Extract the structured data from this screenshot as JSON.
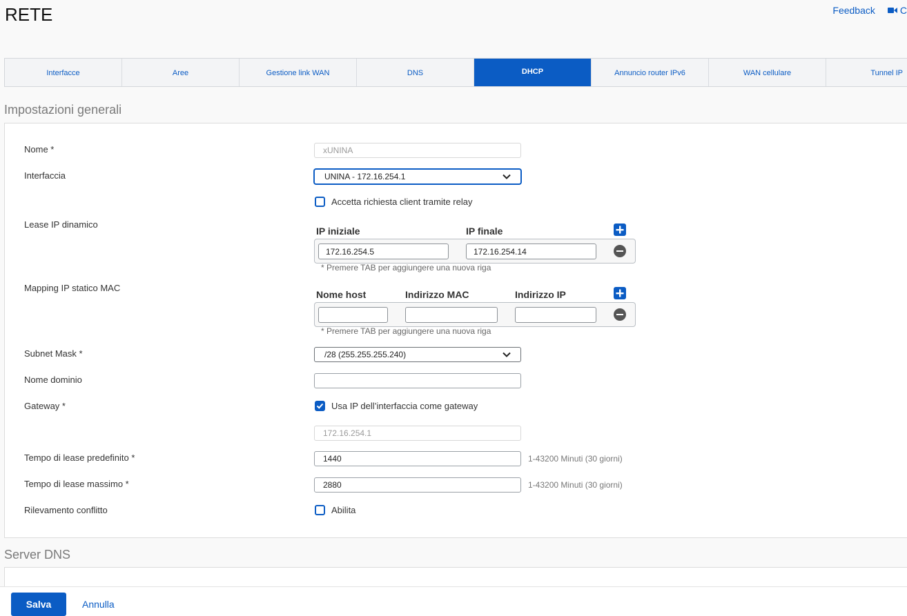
{
  "page": {
    "title": "RETE"
  },
  "header": {
    "feedback": "Feedback",
    "extra": "C"
  },
  "tabs": [
    {
      "label": "Interfacce"
    },
    {
      "label": "Aree"
    },
    {
      "label": "Gestione link WAN"
    },
    {
      "label": "DNS"
    },
    {
      "label": "DHCP",
      "active": true
    },
    {
      "label": "Annuncio router IPv6"
    },
    {
      "label": "WAN cellulare"
    },
    {
      "label": "Tunnel IP"
    }
  ],
  "sections": {
    "general": "Impostazioni generali",
    "dns": "Server DNS"
  },
  "form": {
    "nome": {
      "label": "Nome *",
      "placeholder": "xUNINA"
    },
    "interfaccia": {
      "label": "Interfaccia",
      "value": "UNINA - 172.16.254.1"
    },
    "relay": {
      "label": "Accetta richiesta client tramite relay",
      "checked": false
    },
    "lease": {
      "label": "Lease IP dinamico",
      "col_start": "IP iniziale",
      "col_end": "IP finale",
      "start": "172.16.254.5",
      "end": "172.16.254.14",
      "note": "* Premere TAB per aggiungere una nuova riga"
    },
    "mapping": {
      "label": "Mapping IP statico MAC",
      "col_host": "Nome host",
      "col_mac": "Indirizzo MAC",
      "col_ip": "Indirizzo IP",
      "host": "",
      "mac": "",
      "ip": "",
      "note": "* Premere TAB per aggiungere una nuova riga"
    },
    "subnet": {
      "label": "Subnet Mask *",
      "value": "/28 (255.255.255.240)"
    },
    "dominio": {
      "label": "Nome dominio",
      "value": ""
    },
    "gateway": {
      "label": "Gateway *",
      "checkbox_label": "Usa IP dell’interfaccia come gateway",
      "checked": true,
      "value": "172.16.254.1"
    },
    "lease_default": {
      "label": "Tempo di lease predefinito *",
      "value": "1440",
      "hint": "1-43200 Minuti (30 giorni)"
    },
    "lease_max": {
      "label": "Tempo di lease massimo *",
      "value": "2880",
      "hint": "1-43200 Minuti (30 giorni)"
    },
    "conflitto": {
      "label": "Rilevamento conflitto",
      "checkbox_label": "Abilita",
      "checked": false
    }
  },
  "footer": {
    "save": "Salva",
    "cancel": "Annulla"
  },
  "colors": {
    "accent": "#0b5cc4"
  },
  "icons": {
    "camera": "video-camera-icon",
    "add": "plus-square-icon",
    "remove": "minus-circle-icon",
    "dropdown": "chevron-down-icon",
    "check": "checkmark-icon"
  }
}
